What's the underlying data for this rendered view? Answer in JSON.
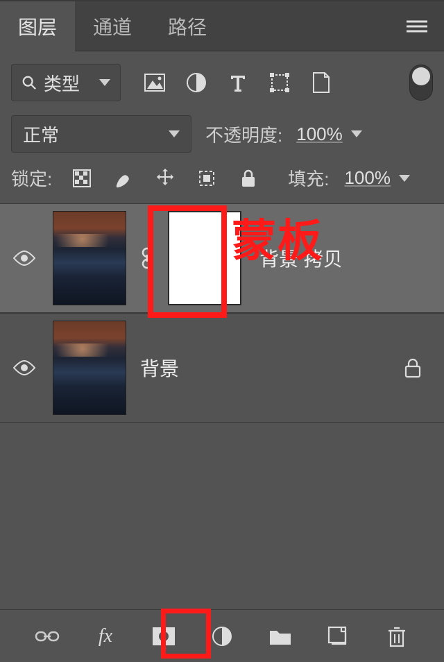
{
  "tabs": {
    "layers": "图层",
    "channels": "通道",
    "paths": "路径"
  },
  "filter": {
    "type_label": "类型"
  },
  "blend": {
    "mode": "正常",
    "opacity_label": "不透明度:",
    "opacity_value": "100%"
  },
  "lock": {
    "label": "锁定:",
    "fill_label": "填充:",
    "fill_value": "100%"
  },
  "layers_list": [
    {
      "name": "背景 拷贝",
      "has_mask": true,
      "locked": false
    },
    {
      "name": "背景",
      "has_mask": false,
      "locked": true
    }
  ],
  "annotation": {
    "mask_label": "蒙板"
  },
  "icons": {
    "search": "search-icon",
    "image": "image-icon",
    "adjust": "adjust-icon",
    "type": "type-icon",
    "shape": "shape-icon",
    "smart": "smart-object-icon",
    "pixels": "lock-pixels-icon",
    "brush": "lock-brush-icon",
    "move": "lock-move-icon",
    "artboard": "lock-artboard-icon",
    "lockall": "lock-all-icon",
    "eye": "visibility-icon",
    "linkchain": "link-icon",
    "fx": "fx-icon",
    "mask": "add-mask-icon",
    "adj": "adjustment-layer-icon",
    "group": "group-icon",
    "new": "new-layer-icon",
    "trash": "delete-icon",
    "menu": "panel-menu-icon"
  }
}
